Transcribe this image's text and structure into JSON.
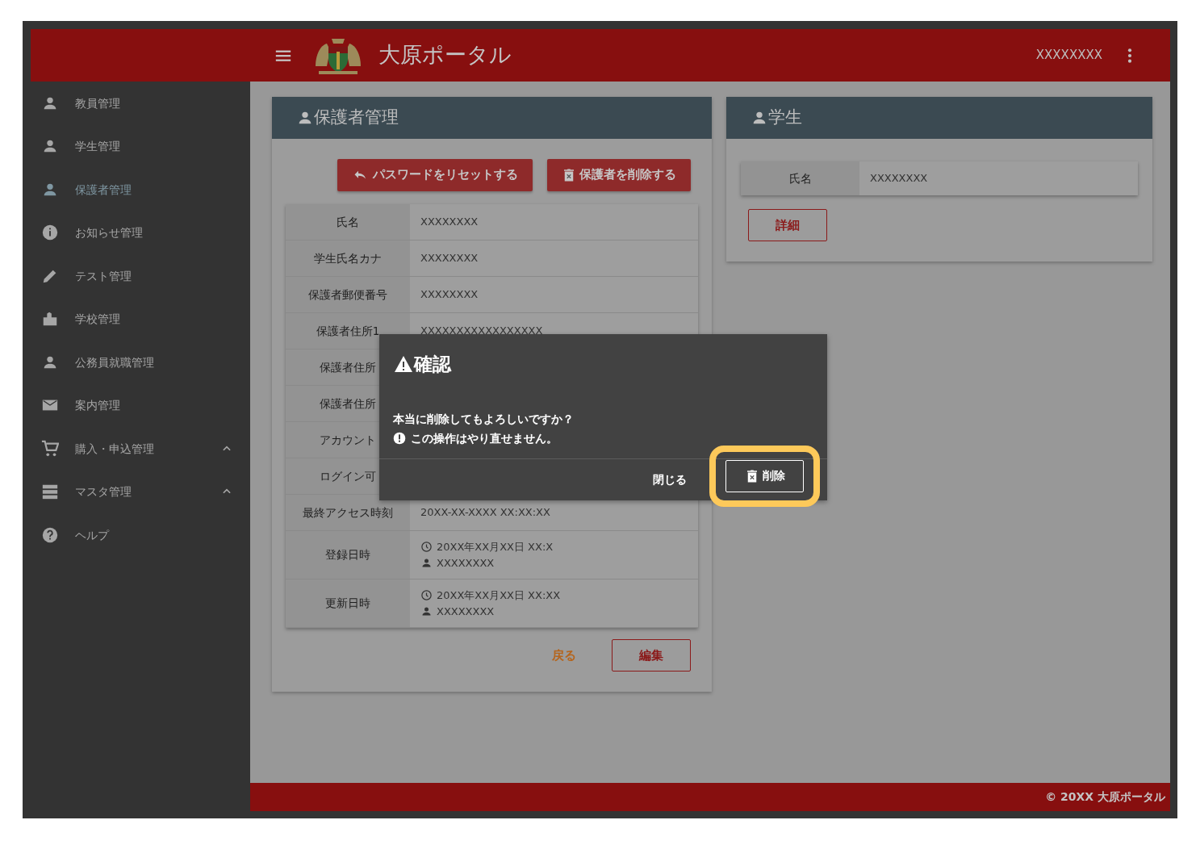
{
  "header": {
    "title": "大原ポータル",
    "user": "XXXXXXXX"
  },
  "sidebar": {
    "items": [
      {
        "label": "教員管理",
        "selected": false,
        "kind": "link"
      },
      {
        "label": "学生管理",
        "selected": false,
        "kind": "link"
      },
      {
        "label": "保護者管理",
        "selected": true,
        "kind": "link"
      },
      {
        "label": "お知らせ管理",
        "selected": false,
        "kind": "link"
      },
      {
        "label": "テスト管理",
        "selected": false,
        "kind": "link"
      },
      {
        "label": "学校管理",
        "selected": false,
        "kind": "link"
      },
      {
        "label": "公務員就職管理",
        "selected": false,
        "kind": "link"
      },
      {
        "label": "案内管理",
        "selected": false,
        "kind": "link"
      },
      {
        "label": "購入・申込管理",
        "selected": false,
        "kind": "group"
      },
      {
        "label": "マスタ管理",
        "selected": false,
        "kind": "group"
      },
      {
        "label": "ヘルプ",
        "selected": false,
        "kind": "link"
      }
    ]
  },
  "guardian_card": {
    "title": "保護者管理",
    "actions": [
      "パスワードをリセットする",
      "保護者を削除する"
    ],
    "fields": [
      {
        "label": "氏名",
        "value": "XXXXXXXX",
        "kind": "text"
      },
      {
        "label": "学生氏名カナ",
        "value": "XXXXXXXX",
        "kind": "text"
      },
      {
        "label": "保護者郵便番号",
        "value": "XXXXXXXX",
        "kind": "text"
      },
      {
        "label": "保護者住所1",
        "value": "XXXXXXXXXXXXXXXXX",
        "kind": "text"
      },
      {
        "label": "保護者住所",
        "kind": "text"
      },
      {
        "label": "保護者住所",
        "kind": "text"
      },
      {
        "label": "アカウント",
        "kind": "text"
      },
      {
        "label": "ログイン可",
        "kind": "text"
      },
      {
        "label": "最終アクセス時刻",
        "value": "20XX-XX-XXXX XX:XX:XX",
        "kind": "text"
      },
      {
        "label": "登録日時",
        "kind": "audit",
        "time": "20XX年XX月XX日 XX:X",
        "user": "XXXXXXXX"
      },
      {
        "label": "更新日時",
        "kind": "audit",
        "time": "20XX年XX月XX日 XX:XX",
        "user": "XXXXXXXX"
      }
    ],
    "footer_buttons": [
      {
        "label": "戻る",
        "kind": "text"
      },
      {
        "label": "編集",
        "kind": "outlined"
      }
    ]
  },
  "student_card": {
    "title": "学生",
    "fields": [
      {
        "label": "氏名",
        "value": "XXXXXXXX"
      }
    ],
    "button": "詳細"
  },
  "dialog": {
    "title": "確認",
    "message": "本当に削除してもよろしいですか？",
    "warning": "この操作はやり直せません。",
    "buttons": [
      {
        "label": "閉じる",
        "kind": "text",
        "focused": false
      },
      {
        "label": "削除",
        "kind": "outlined",
        "focused": true
      }
    ]
  },
  "footer": "© 20XX 大原ポータル"
}
